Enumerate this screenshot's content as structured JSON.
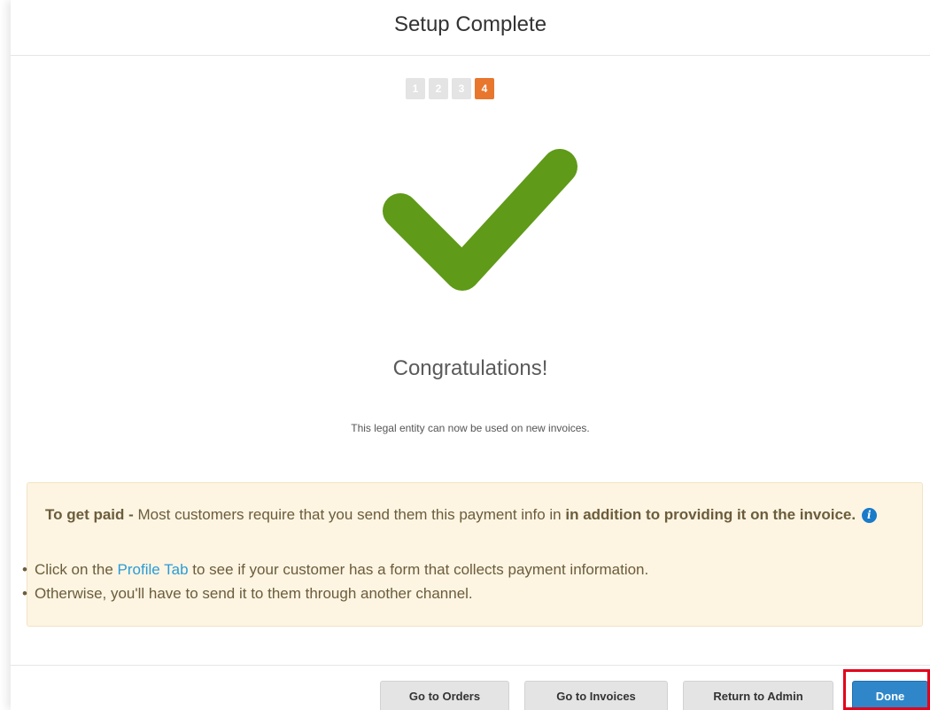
{
  "modal": {
    "title": "Setup Complete"
  },
  "steps": [
    {
      "label": "1",
      "active": false
    },
    {
      "label": "2",
      "active": false
    },
    {
      "label": "3",
      "active": false
    },
    {
      "label": "4",
      "active": true
    }
  ],
  "colors": {
    "accent_orange": "#e8762d",
    "success_green": "#5f9a18",
    "primary_blue": "#2f87c9",
    "link_blue": "#2b9bd6",
    "notice_bg": "#fdf5e2",
    "highlight_red": "#e3001b"
  },
  "icons": {
    "success": "checkmark-icon",
    "info": "info-icon"
  },
  "success": {
    "heading": "Congratulations!",
    "message": "This legal entity can now be used on new invoices."
  },
  "notice": {
    "lead_bold": "To get paid -",
    "lead_text": " Most customers require that you send them this payment info in ",
    "lead_emphasis": "in addition to providing it on the invoice.",
    "info_glyph": "i",
    "bullet1_before": "Click on the ",
    "bullet1_link": "Profile Tab",
    "bullet1_after": " to see if your customer has a form that collects payment information.",
    "bullet2": "Otherwise, you'll have to send it to them through another channel."
  },
  "footer": {
    "orders_label": "Go to Orders",
    "invoices_label": "Go to Invoices",
    "admin_label": "Return to Admin",
    "done_label": "Done"
  }
}
